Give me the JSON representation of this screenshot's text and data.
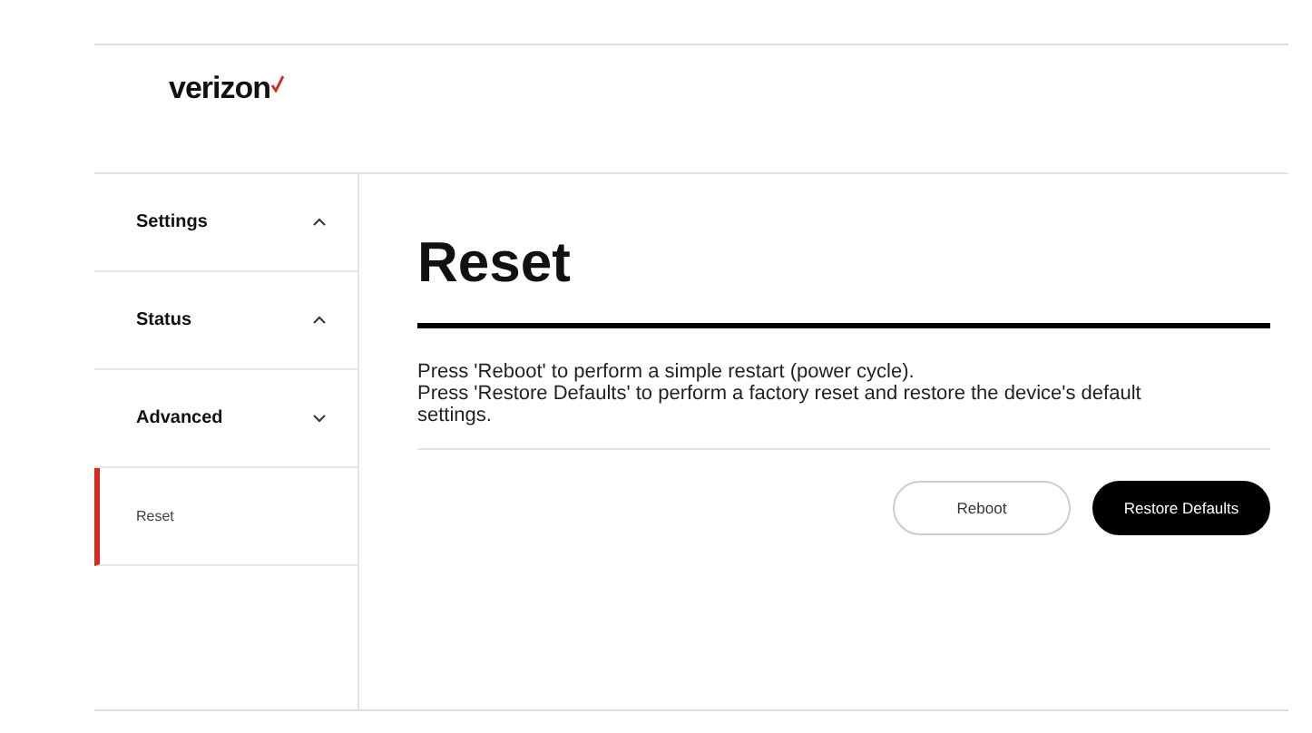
{
  "header": {
    "logo": "verizon"
  },
  "sidebar": {
    "items": [
      {
        "label": "Settings",
        "expanded": false
      },
      {
        "label": "Status",
        "expanded": false
      },
      {
        "label": "Advanced",
        "expanded": true,
        "children": [
          {
            "label": "Reset",
            "selected": true
          }
        ]
      }
    ]
  },
  "main": {
    "title": "Reset",
    "description": [
      "Press 'Reboot' to perform a simple restart (power cycle).",
      "Press 'Restore Defaults' to perform a factory reset and restore the device's default settings."
    ],
    "buttons": [
      {
        "label": "Reboot",
        "kind": "secondary"
      },
      {
        "label": "Restore Defaults",
        "kind": "primary"
      }
    ]
  }
}
